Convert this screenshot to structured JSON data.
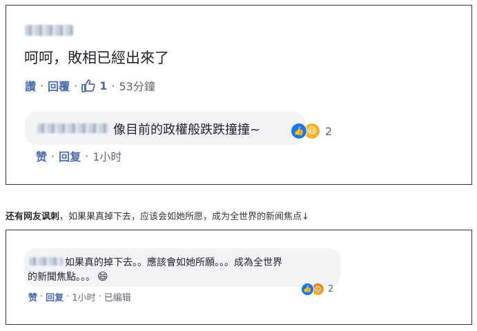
{
  "comment1": {
    "text": "呵呵，敗相已經出來了",
    "actions": {
      "read": "讚",
      "sep": "·",
      "reply": "回覆",
      "like_count": "1",
      "time": "53分鐘"
    },
    "reply": {
      "text": "像目前的政權般跌跌撞撞~",
      "reaction_count": "2",
      "actions": {
        "like": "赞",
        "sep": "·",
        "reply": "回复",
        "time": "1小时"
      }
    }
  },
  "intro": {
    "highlight": "还有网友讽刺",
    "text": "，如果果真掉下去，应该会如她所愿，成为全世界的新闻焦点↓"
  },
  "comment2": {
    "line1": "如果真的掉下去。。應該會如她所願。。。成為全世界",
    "line2": "的新聞焦點。。。",
    "emoji": "😄",
    "reaction_count": "2",
    "actions": {
      "like": "赞",
      "sep": "·",
      "reply": "回复",
      "time": "1小时",
      "edited": "已编辑"
    }
  },
  "icons": [
    "thumbs-up-icon",
    "like-reaction-icon",
    "haha-reaction-icon",
    "angry-reaction-icon",
    "smile-emoji-icon"
  ]
}
